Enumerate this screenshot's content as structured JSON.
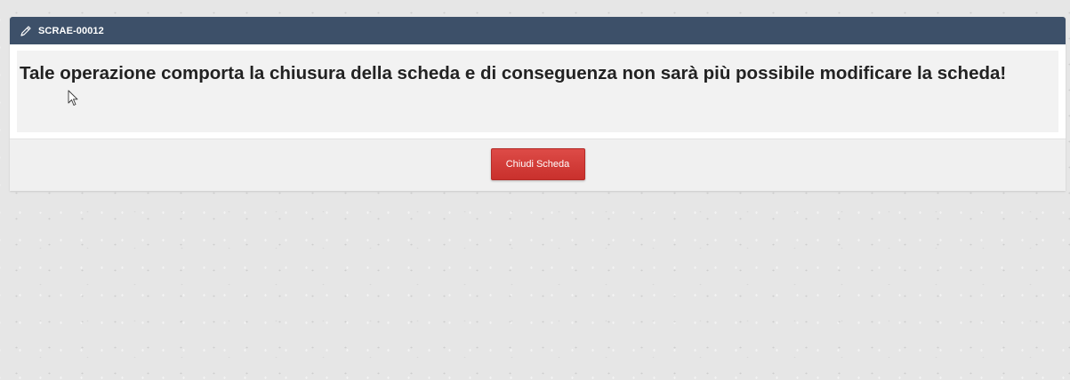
{
  "dialog": {
    "title": "SCRAE-00012",
    "icon": "edit-pencil-icon",
    "message": "Tale operazione comporta la chiusura della scheda e di conseguenza non sarà più possibile modificare la scheda!",
    "close_button_label": "Chiudi Scheda"
  },
  "colors": {
    "header_bg": "#3d5069",
    "button_bg": "#d9534f",
    "page_bg": "#e6e6e6"
  }
}
